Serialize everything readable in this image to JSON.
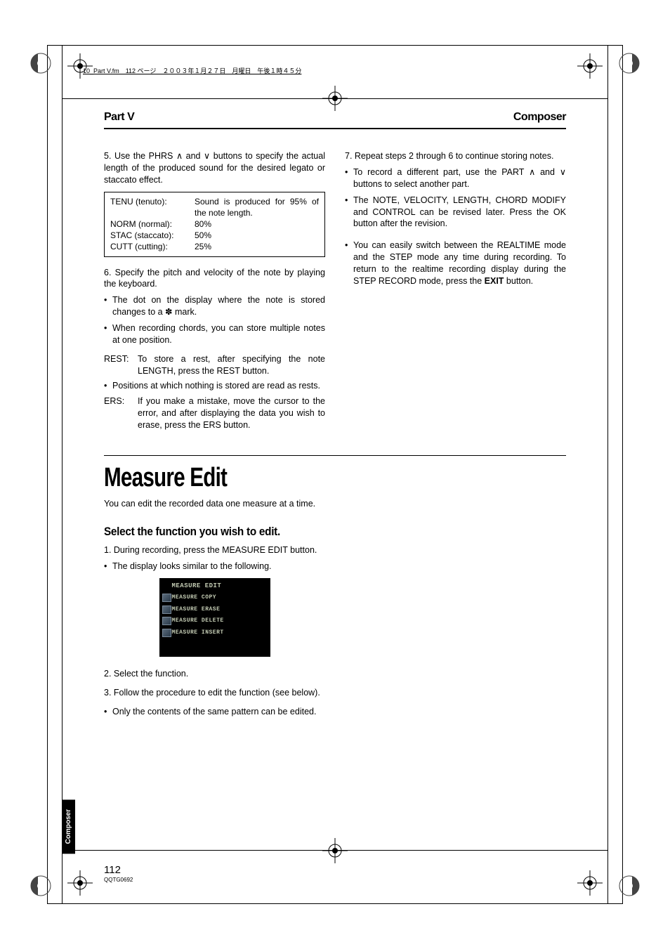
{
  "slug": "10_Part V.fm　112 ページ　２００３年１月２７日　月曜日　午後１時４５分",
  "header": {
    "left": "Part V",
    "right": "Composer"
  },
  "col1": {
    "step5": "5. Use the PHRS ∧ and ∨ buttons to specify the actual length of the produced sound for the desired legato or staccato effect.",
    "box": {
      "rows": [
        {
          "k": "TENU (tenuto):",
          "v": "Sound is produced for 95% of the note length."
        },
        {
          "k": "NORM (normal):",
          "v": "80%"
        },
        {
          "k": "STAC (staccato):",
          "v": "50%"
        },
        {
          "k": "CUTT (cutting):",
          "v": "25%"
        }
      ]
    },
    "step6": "6. Specify the pitch and velocity of the note by playing the keyboard.",
    "b1": "The dot on the display where the note is stored changes to a ✽ mark.",
    "b2": "When recording chords, you can store multiple notes at one position.",
    "rest_k": "REST:",
    "rest_v": "To store a rest, after specifying the note LENGTH, press the REST button.",
    "b3": "Positions at which nothing is stored are read as rests.",
    "ers_k": "ERS:",
    "ers_v": "If you make a mistake, move the cursor to the error, and after displaying the data you wish to erase, press the ERS button."
  },
  "col2": {
    "step7": "7. Repeat steps 2 through 6 to continue storing notes.",
    "b1": "To record a different part, use the PART ∧ and ∨ buttons to select another part.",
    "b2": "The NOTE, VELOCITY, LENGTH, CHORD MODIFY and CONTROL can be revised later. Press the OK button after the revision.",
    "b3a": "You can easily switch between the REALTIME mode and the STEP mode any time during recording. To return to the realtime recording display during the STEP RECORD mode, press the ",
    "b3bold": "EXIT",
    "b3b": " button."
  },
  "section": {
    "title": "Measure Edit",
    "intro": "You can edit the recorded data one measure at a time.",
    "subtitle": "Select the function you wish to edit.",
    "step1": "1. During recording, press the MEASURE EDIT button.",
    "b1": "The display looks similar to the following.",
    "screen": {
      "title": "MEASURE EDIT",
      "items": [
        "MEASURE COPY",
        "MEASURE ERASE",
        "MEASURE DELETE",
        "MEASURE INSERT"
      ]
    },
    "step2": "2. Select the function.",
    "step3": "3. Follow the procedure to edit the function (see below).",
    "b2": "Only the contents of the same pattern can be edited."
  },
  "sidetab": "Composer",
  "folio": {
    "num": "112",
    "code": "QQTG0692"
  }
}
